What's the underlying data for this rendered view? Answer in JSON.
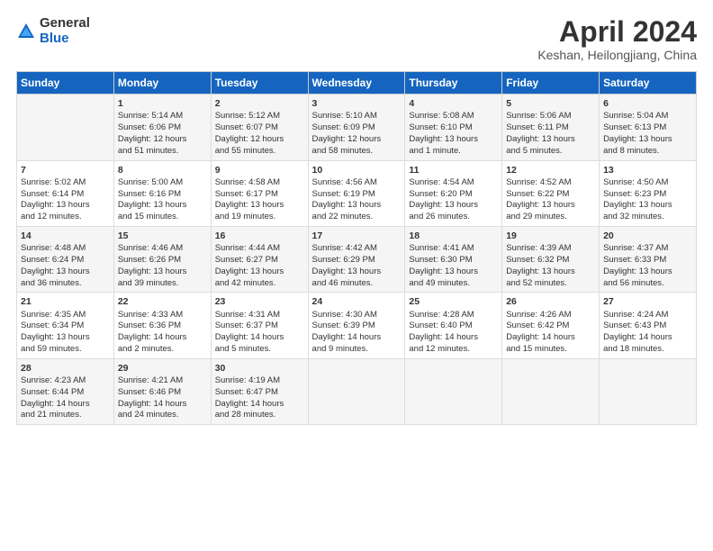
{
  "logo": {
    "general": "General",
    "blue": "Blue"
  },
  "title": "April 2024",
  "subtitle": "Keshan, Heilongjiang, China",
  "calendar": {
    "headers": [
      "Sunday",
      "Monday",
      "Tuesday",
      "Wednesday",
      "Thursday",
      "Friday",
      "Saturday"
    ],
    "rows": [
      [
        {
          "day": "",
          "lines": []
        },
        {
          "day": "1",
          "lines": [
            "Sunrise: 5:14 AM",
            "Sunset: 6:06 PM",
            "Daylight: 12 hours",
            "and 51 minutes."
          ]
        },
        {
          "day": "2",
          "lines": [
            "Sunrise: 5:12 AM",
            "Sunset: 6:07 PM",
            "Daylight: 12 hours",
            "and 55 minutes."
          ]
        },
        {
          "day": "3",
          "lines": [
            "Sunrise: 5:10 AM",
            "Sunset: 6:09 PM",
            "Daylight: 12 hours",
            "and 58 minutes."
          ]
        },
        {
          "day": "4",
          "lines": [
            "Sunrise: 5:08 AM",
            "Sunset: 6:10 PM",
            "Daylight: 13 hours",
            "and 1 minute."
          ]
        },
        {
          "day": "5",
          "lines": [
            "Sunrise: 5:06 AM",
            "Sunset: 6:11 PM",
            "Daylight: 13 hours",
            "and 5 minutes."
          ]
        },
        {
          "day": "6",
          "lines": [
            "Sunrise: 5:04 AM",
            "Sunset: 6:13 PM",
            "Daylight: 13 hours",
            "and 8 minutes."
          ]
        }
      ],
      [
        {
          "day": "7",
          "lines": [
            "Sunrise: 5:02 AM",
            "Sunset: 6:14 PM",
            "Daylight: 13 hours",
            "and 12 minutes."
          ]
        },
        {
          "day": "8",
          "lines": [
            "Sunrise: 5:00 AM",
            "Sunset: 6:16 PM",
            "Daylight: 13 hours",
            "and 15 minutes."
          ]
        },
        {
          "day": "9",
          "lines": [
            "Sunrise: 4:58 AM",
            "Sunset: 6:17 PM",
            "Daylight: 13 hours",
            "and 19 minutes."
          ]
        },
        {
          "day": "10",
          "lines": [
            "Sunrise: 4:56 AM",
            "Sunset: 6:19 PM",
            "Daylight: 13 hours",
            "and 22 minutes."
          ]
        },
        {
          "day": "11",
          "lines": [
            "Sunrise: 4:54 AM",
            "Sunset: 6:20 PM",
            "Daylight: 13 hours",
            "and 26 minutes."
          ]
        },
        {
          "day": "12",
          "lines": [
            "Sunrise: 4:52 AM",
            "Sunset: 6:22 PM",
            "Daylight: 13 hours",
            "and 29 minutes."
          ]
        },
        {
          "day": "13",
          "lines": [
            "Sunrise: 4:50 AM",
            "Sunset: 6:23 PM",
            "Daylight: 13 hours",
            "and 32 minutes."
          ]
        }
      ],
      [
        {
          "day": "14",
          "lines": [
            "Sunrise: 4:48 AM",
            "Sunset: 6:24 PM",
            "Daylight: 13 hours",
            "and 36 minutes."
          ]
        },
        {
          "day": "15",
          "lines": [
            "Sunrise: 4:46 AM",
            "Sunset: 6:26 PM",
            "Daylight: 13 hours",
            "and 39 minutes."
          ]
        },
        {
          "day": "16",
          "lines": [
            "Sunrise: 4:44 AM",
            "Sunset: 6:27 PM",
            "Daylight: 13 hours",
            "and 42 minutes."
          ]
        },
        {
          "day": "17",
          "lines": [
            "Sunrise: 4:42 AM",
            "Sunset: 6:29 PM",
            "Daylight: 13 hours",
            "and 46 minutes."
          ]
        },
        {
          "day": "18",
          "lines": [
            "Sunrise: 4:41 AM",
            "Sunset: 6:30 PM",
            "Daylight: 13 hours",
            "and 49 minutes."
          ]
        },
        {
          "day": "19",
          "lines": [
            "Sunrise: 4:39 AM",
            "Sunset: 6:32 PM",
            "Daylight: 13 hours",
            "and 52 minutes."
          ]
        },
        {
          "day": "20",
          "lines": [
            "Sunrise: 4:37 AM",
            "Sunset: 6:33 PM",
            "Daylight: 13 hours",
            "and 56 minutes."
          ]
        }
      ],
      [
        {
          "day": "21",
          "lines": [
            "Sunrise: 4:35 AM",
            "Sunset: 6:34 PM",
            "Daylight: 13 hours",
            "and 59 minutes."
          ]
        },
        {
          "day": "22",
          "lines": [
            "Sunrise: 4:33 AM",
            "Sunset: 6:36 PM",
            "Daylight: 14 hours",
            "and 2 minutes."
          ]
        },
        {
          "day": "23",
          "lines": [
            "Sunrise: 4:31 AM",
            "Sunset: 6:37 PM",
            "Daylight: 14 hours",
            "and 5 minutes."
          ]
        },
        {
          "day": "24",
          "lines": [
            "Sunrise: 4:30 AM",
            "Sunset: 6:39 PM",
            "Daylight: 14 hours",
            "and 9 minutes."
          ]
        },
        {
          "day": "25",
          "lines": [
            "Sunrise: 4:28 AM",
            "Sunset: 6:40 PM",
            "Daylight: 14 hours",
            "and 12 minutes."
          ]
        },
        {
          "day": "26",
          "lines": [
            "Sunrise: 4:26 AM",
            "Sunset: 6:42 PM",
            "Daylight: 14 hours",
            "and 15 minutes."
          ]
        },
        {
          "day": "27",
          "lines": [
            "Sunrise: 4:24 AM",
            "Sunset: 6:43 PM",
            "Daylight: 14 hours",
            "and 18 minutes."
          ]
        }
      ],
      [
        {
          "day": "28",
          "lines": [
            "Sunrise: 4:23 AM",
            "Sunset: 6:44 PM",
            "Daylight: 14 hours",
            "and 21 minutes."
          ]
        },
        {
          "day": "29",
          "lines": [
            "Sunrise: 4:21 AM",
            "Sunset: 6:46 PM",
            "Daylight: 14 hours",
            "and 24 minutes."
          ]
        },
        {
          "day": "30",
          "lines": [
            "Sunrise: 4:19 AM",
            "Sunset: 6:47 PM",
            "Daylight: 14 hours",
            "and 28 minutes."
          ]
        },
        {
          "day": "",
          "lines": []
        },
        {
          "day": "",
          "lines": []
        },
        {
          "day": "",
          "lines": []
        },
        {
          "day": "",
          "lines": []
        }
      ]
    ]
  }
}
